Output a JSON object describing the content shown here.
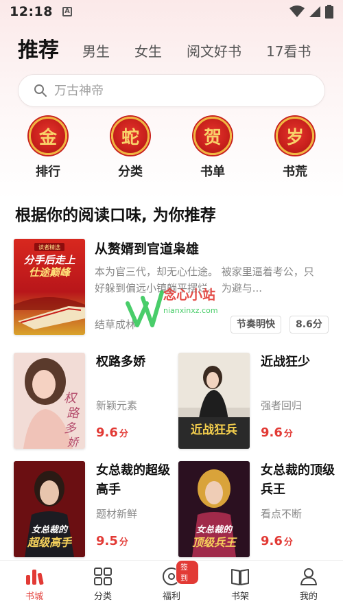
{
  "status_bar": {
    "time": "12:18",
    "notif_letter": "A"
  },
  "tabs": [
    {
      "label": "推荐",
      "active": true
    },
    {
      "label": "男生"
    },
    {
      "label": "女生"
    },
    {
      "label": "阅文好书"
    },
    {
      "label": "17看书"
    }
  ],
  "search": {
    "placeholder": "万古神帝"
  },
  "quick_entries": [
    {
      "glyph": "金",
      "label": "排行"
    },
    {
      "glyph": "蛇",
      "label": "分类"
    },
    {
      "glyph": "贺",
      "label": "书单"
    },
    {
      "glyph": "岁",
      "label": "书荒"
    }
  ],
  "section": {
    "title": "根据你的阅读口味, 为你推荐"
  },
  "featured_book": {
    "title": "从赘婿到官道枭雄",
    "desc": "本为官三代，却无心仕途。 被家里逼着考公，只好躲到偏远小镇躺平摆烂。 为避与...",
    "author": "结草成林",
    "tag": "节奏明快",
    "score": "8.6分",
    "cover_text_1": "分手后走上",
    "cover_text_2": "仕途巅峰",
    "cover_badge": "读者精选"
  },
  "grid_books": [
    {
      "title": "权路多娇",
      "author": "新颖元素",
      "score": "9.6",
      "unit": "分",
      "cover_text": "权路多娇"
    },
    {
      "title": "近战狂少",
      "author": "强者回归",
      "score": "9.6",
      "unit": "分",
      "cover_text": "近战狂兵"
    },
    {
      "title": "女总裁的超级高手",
      "author": "题材新鲜",
      "score": "9.5",
      "unit": "分",
      "cover_text": "女总裁的超级高手"
    },
    {
      "title": "女总裁的顶级兵王",
      "author": "看点不断",
      "score": "9.6",
      "unit": "分",
      "cover_text": "女总裁的顶级兵王"
    }
  ],
  "watermark": {
    "text": "念心小站",
    "url": "nianxinxz.com"
  },
  "bottom_nav": [
    {
      "label": "书城",
      "icon": "bookstore-icon",
      "active": true
    },
    {
      "label": "分类",
      "icon": "category-grid-icon"
    },
    {
      "label": "福利",
      "icon": "welfare-disc-icon",
      "badge": "签到"
    },
    {
      "label": "书架",
      "icon": "bookshelf-icon"
    },
    {
      "label": "我的",
      "icon": "profile-icon"
    }
  ],
  "colors": {
    "accent": "#e23a35",
    "medal_red": "#c8201c",
    "medal_gold": "#f1b640"
  }
}
